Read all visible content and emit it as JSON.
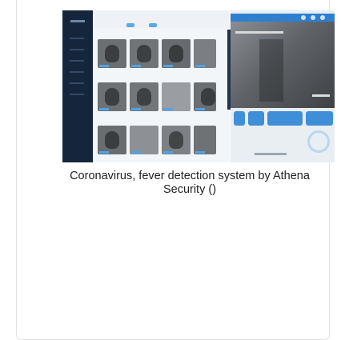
{
  "figure": {
    "caption": "Coronavirus, fever detection system by Athena Security ()",
    "image_description_icon": "dashboard-screenshot-image"
  },
  "colors": {
    "sidebar": "#15263c",
    "accent": "#2e7fd0",
    "tag": "#4da3e8",
    "caption_text": "#222222"
  }
}
